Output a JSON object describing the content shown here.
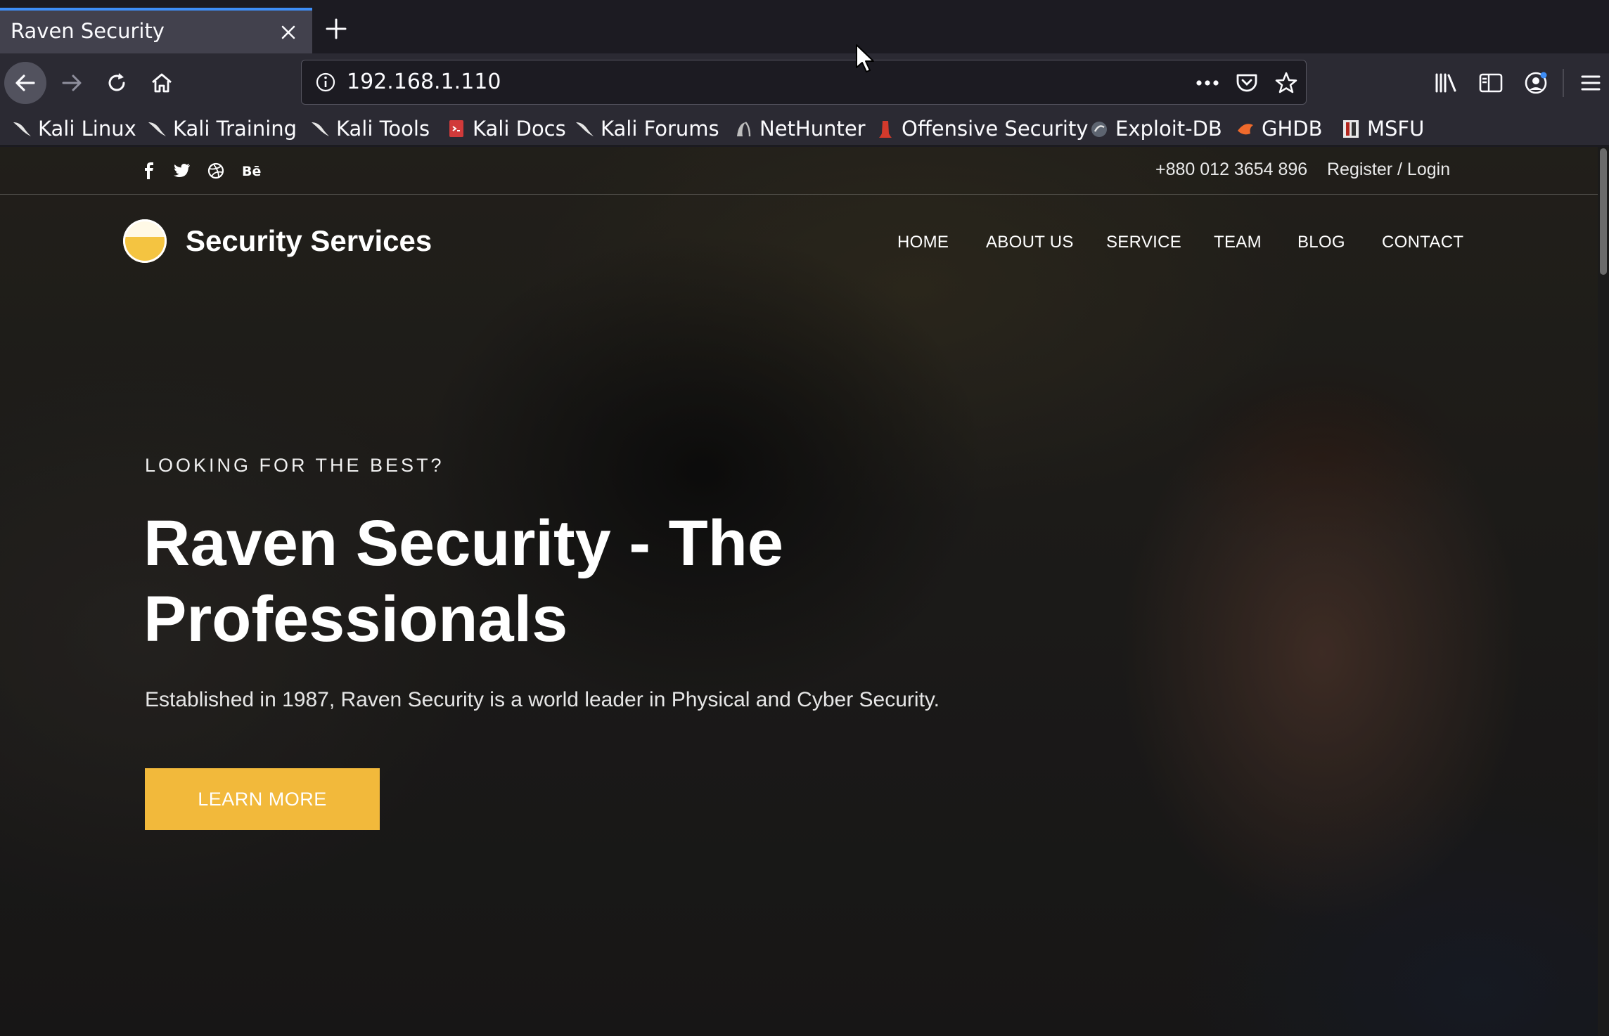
{
  "browser": {
    "tab_title": "Raven Security",
    "url": "192.168.1.110",
    "accent_color": "#3e8ef7"
  },
  "bookmarks": [
    {
      "label": "Kali Linux",
      "icon": "kali-dragon-icon"
    },
    {
      "label": "Kali Training",
      "icon": "kali-dragon-icon"
    },
    {
      "label": "Kali Tools",
      "icon": "kali-dragon-icon"
    },
    {
      "label": "Kali Docs",
      "icon": "kali-docs-icon"
    },
    {
      "label": "Kali Forums",
      "icon": "kali-dragon-icon"
    },
    {
      "label": "NetHunter",
      "icon": "nethunter-icon"
    },
    {
      "label": "Offensive Security",
      "icon": "offsec-icon"
    },
    {
      "label": "Exploit-DB",
      "icon": "exploitdb-icon"
    },
    {
      "label": "GHDB",
      "icon": "ghdb-icon"
    },
    {
      "label": "MSFU",
      "icon": "msfu-icon"
    }
  ],
  "site": {
    "social_icons": [
      "facebook-icon",
      "twitter-icon",
      "dribbble-icon",
      "behance-icon"
    ],
    "phone": "+880 012 3654 896",
    "login": "Register / Login",
    "brand": "Security Services",
    "menu": [
      "HOME",
      "ABOUT US",
      "SERVICE",
      "TEAM",
      "BLOG",
      "CONTACT"
    ],
    "hero": {
      "eyebrow": "LOOKING FOR THE BEST?",
      "title": "Raven Security - The Professionals",
      "subtitle": "Established in 1987, Raven Security is a world leader in Physical and Cyber Security.",
      "cta": "LEARN MORE"
    },
    "cta_color": "#f2b93b"
  }
}
